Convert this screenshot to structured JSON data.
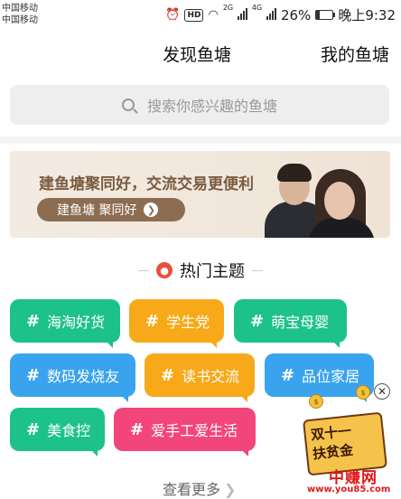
{
  "status_bar": {
    "carrier_1": "中国移动",
    "carrier_2": "中国移动",
    "hd": "HD",
    "net_1": "2G",
    "net_2": "4G",
    "battery": "26%",
    "time": "晚上9:32"
  },
  "tabs": {
    "discover": "发现鱼塘",
    "mine": "我的鱼塘"
  },
  "search": {
    "placeholder": "搜索你感兴趣的鱼塘"
  },
  "banner": {
    "headline": "建鱼塘聚同好，交流交易更便利",
    "button": "建鱼塘 聚同好"
  },
  "hot_topics": {
    "title": "热门主题",
    "tags": [
      "海淘好货",
      "学生党",
      "萌宝母婴",
      "数码发烧友",
      "读书交流",
      "品位家居",
      "美食控",
      "爱手工爱生活"
    ],
    "more": "查看更多"
  },
  "promo": {
    "line_1": "双十一",
    "line_2": "扶贫金",
    "watermark_cn": "中赚网",
    "watermark_url": "www.you85.com"
  },
  "colors": {
    "green": "#1dc28a",
    "orange": "#f8a919",
    "blue": "#3aa3ee",
    "pink": "#f2457b",
    "banner_button": "#8c6d52"
  }
}
